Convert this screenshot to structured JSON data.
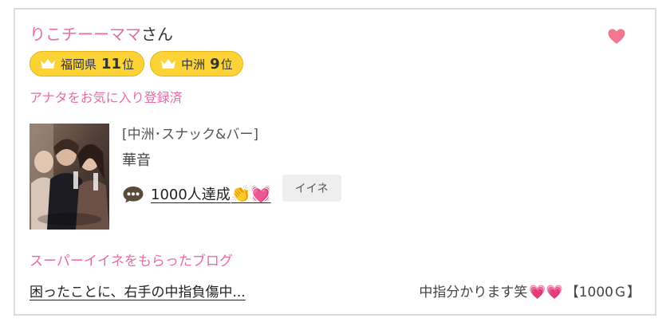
{
  "user": {
    "nickname": "りこチーーママ",
    "honorific": "さん"
  },
  "favorite_heart_icon": "heart-icon",
  "badges": [
    {
      "area": "福岡県",
      "rank": "11",
      "unit": "位",
      "icon": "crown-icon"
    },
    {
      "area": "中洲",
      "rank": "9",
      "unit": "位",
      "icon": "crown-icon"
    }
  ],
  "favorite_status": "アナタをお気に入り登録済",
  "cast": {
    "category": "[中洲･スナック&バー]",
    "name": "華音"
  },
  "comment": {
    "icon": "speech-bubble-icon",
    "text": "1000人達成",
    "emoji": "👏💓",
    "like_label": "イイネ"
  },
  "blog": {
    "heading": "スーパーイイネをもらったブログ",
    "title": "困ったことに、右手の中指負傷中...",
    "meta_text": "中指分かります笑",
    "meta_hearts": "💗💗",
    "points": "【1000Ｇ】"
  },
  "colors": {
    "pink": "#e86aa7",
    "badge_yellow": "#fbd336",
    "heart": "#f0798f"
  }
}
